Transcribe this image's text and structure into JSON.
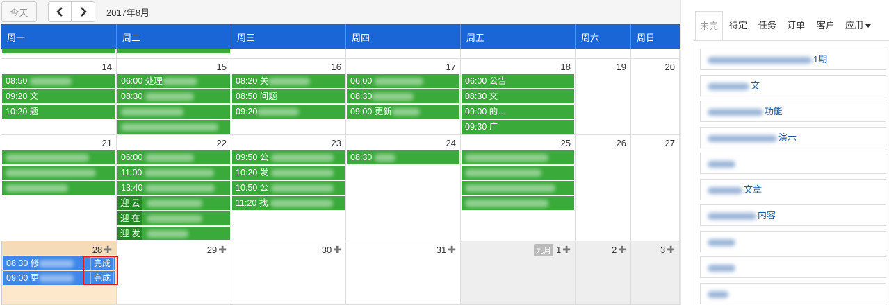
{
  "toolbar": {
    "today_label": "今天",
    "prev_icon": "chevron-left-icon",
    "next_icon": "chevron-right-icon",
    "month_title": "2017年8月"
  },
  "weekdays": [
    "周一",
    "周二",
    "周三",
    "周四",
    "周五",
    "周六",
    "周日"
  ],
  "weeks": [
    {
      "days": [
        "14",
        "15",
        "16",
        "17",
        "18",
        "19",
        "20"
      ]
    },
    {
      "days": [
        "21",
        "22",
        "23",
        "24",
        "25",
        "26",
        "27"
      ]
    },
    {
      "days": [
        "28",
        "29",
        "30",
        "31",
        "1",
        "2",
        "3"
      ],
      "next_month_badge": "九月"
    }
  ],
  "events": {
    "mon14": [
      "08:50",
      "09:20 文",
      "10:20 题"
    ],
    "tue15": [
      "06:00 处理",
      "08:30",
      "",
      ""
    ],
    "wed16": [
      "08:20 关",
      "08:50 问题",
      "09:20"
    ],
    "thu17": [
      "06:00",
      "08:30",
      "09:00 更新"
    ],
    "fri18": [
      "06:00 公告",
      "08:30 文",
      "09:00 的…",
      "09:30 广"
    ],
    "mon21": [
      "",
      "",
      ""
    ],
    "tue22": [
      "06:00",
      "11:00",
      "13:40",
      "迎 云",
      "迎 在",
      "迎 发"
    ],
    "wed23": [
      "09:50 公",
      "10:20 发",
      "10:50 公",
      "11:20 找"
    ],
    "thu24": [
      "08:30"
    ],
    "fri25": [
      "",
      "",
      "",
      ""
    ],
    "mon28": [
      "08:30 修",
      "09:00 更"
    ]
  },
  "done_label": "完成",
  "sidebar": {
    "tabs": [
      "未完",
      "待定",
      "任务",
      "订单",
      "客户",
      "应用"
    ],
    "items": [
      "1期",
      "文",
      "功能",
      "演示",
      "",
      "文章",
      "内容",
      "",
      "",
      ""
    ]
  }
}
